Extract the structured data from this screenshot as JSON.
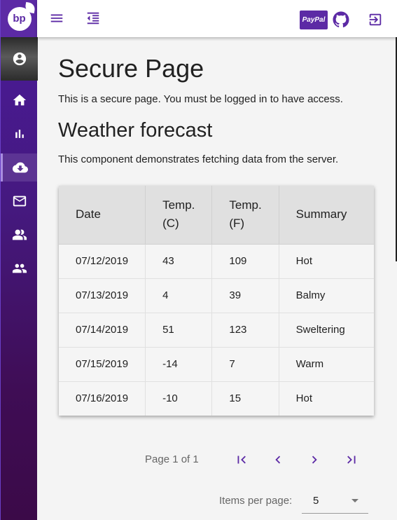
{
  "sidebar": {
    "logo_text": "bp",
    "items": [
      {
        "name": "home-icon"
      },
      {
        "name": "chart-icon"
      },
      {
        "name": "cloud-download-icon"
      },
      {
        "name": "mail-icon"
      },
      {
        "name": "people-icon"
      },
      {
        "name": "group-icon"
      }
    ]
  },
  "header": {
    "paypal_label": "PayPal"
  },
  "main": {
    "title": "Secure Page",
    "description": "This is a secure page. You must be logged in to have access.",
    "section_title": "Weather forecast",
    "section_description": "This component demonstrates fetching data from the server."
  },
  "table": {
    "headers": [
      "Date",
      "Temp.\n(C)",
      "Temp.\n(F)",
      "Summary"
    ],
    "rows": [
      [
        "07/12/2019",
        "43",
        "109",
        "Hot"
      ],
      [
        "07/13/2019",
        "4",
        "39",
        "Balmy"
      ],
      [
        "07/14/2019",
        "51",
        "123",
        "Sweltering"
      ],
      [
        "07/15/2019",
        "-14",
        "7",
        "Warm"
      ],
      [
        "07/16/2019",
        "-10",
        "15",
        "Hot"
      ]
    ]
  },
  "paginator": {
    "range_label": "Page 1 of 1",
    "items_per_page_label": "Items per page:",
    "items_per_page_value": "5"
  },
  "colors": {
    "brand": "#5c2aa5",
    "sidebar_bottom": "#3b0a48",
    "icon_purple": "#5c2aa5"
  }
}
